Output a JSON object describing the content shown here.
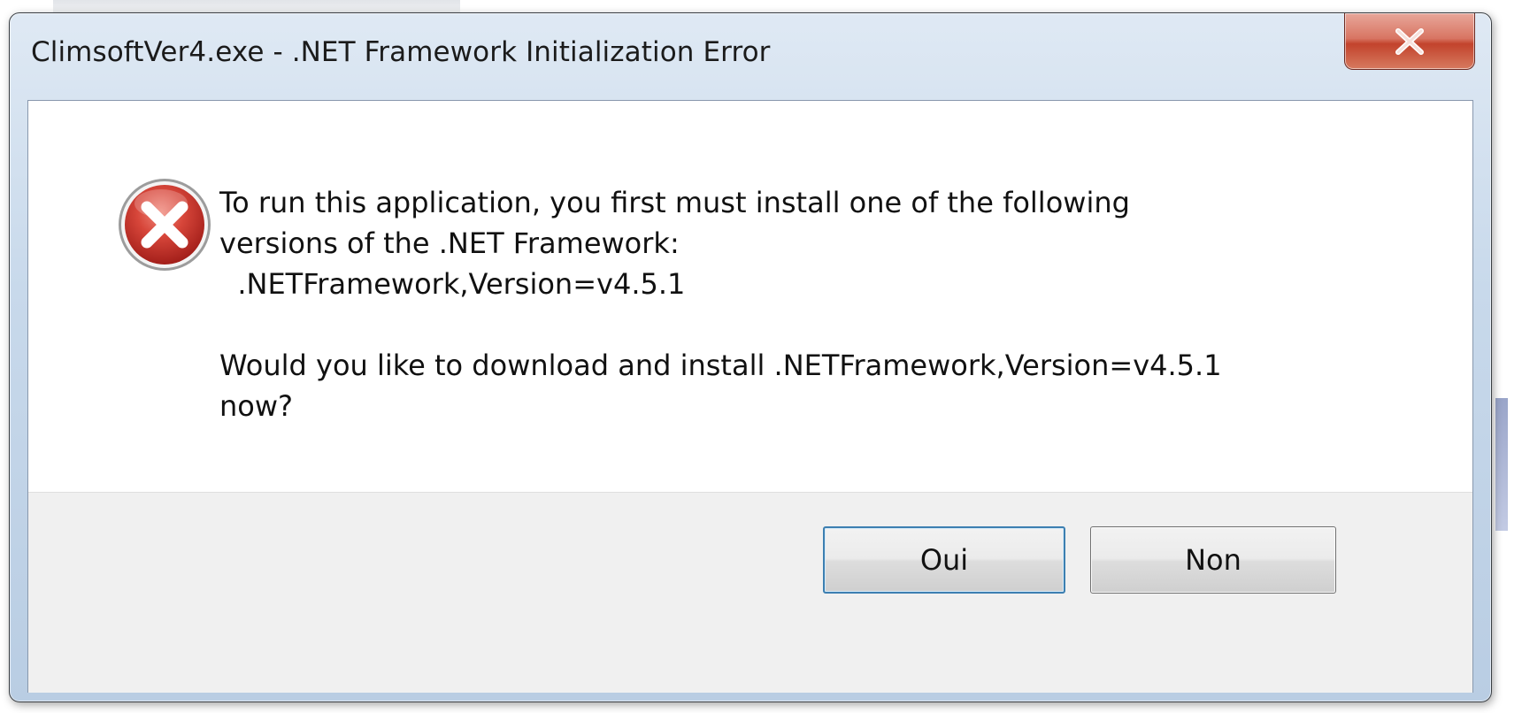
{
  "window": {
    "title": "ClimsoftVer4.exe - .NET Framework Initialization Error",
    "close_icon": "close-icon"
  },
  "dialog": {
    "icon": "error-icon",
    "message_lines": [
      "To run this application, you first must install one of the following",
      "versions of the .NET Framework:",
      "  .NETFramework,Version=v4.5.1"
    ],
    "question_lines": [
      "Would you like to download and install .NETFramework,Version=v4.5.1",
      "now?"
    ]
  },
  "buttons": {
    "yes_label": "Oui",
    "no_label": "Non"
  },
  "colors": {
    "error_red": "#c8302a",
    "close_button": "#c2432c",
    "default_button_border": "#3c7fb1"
  }
}
